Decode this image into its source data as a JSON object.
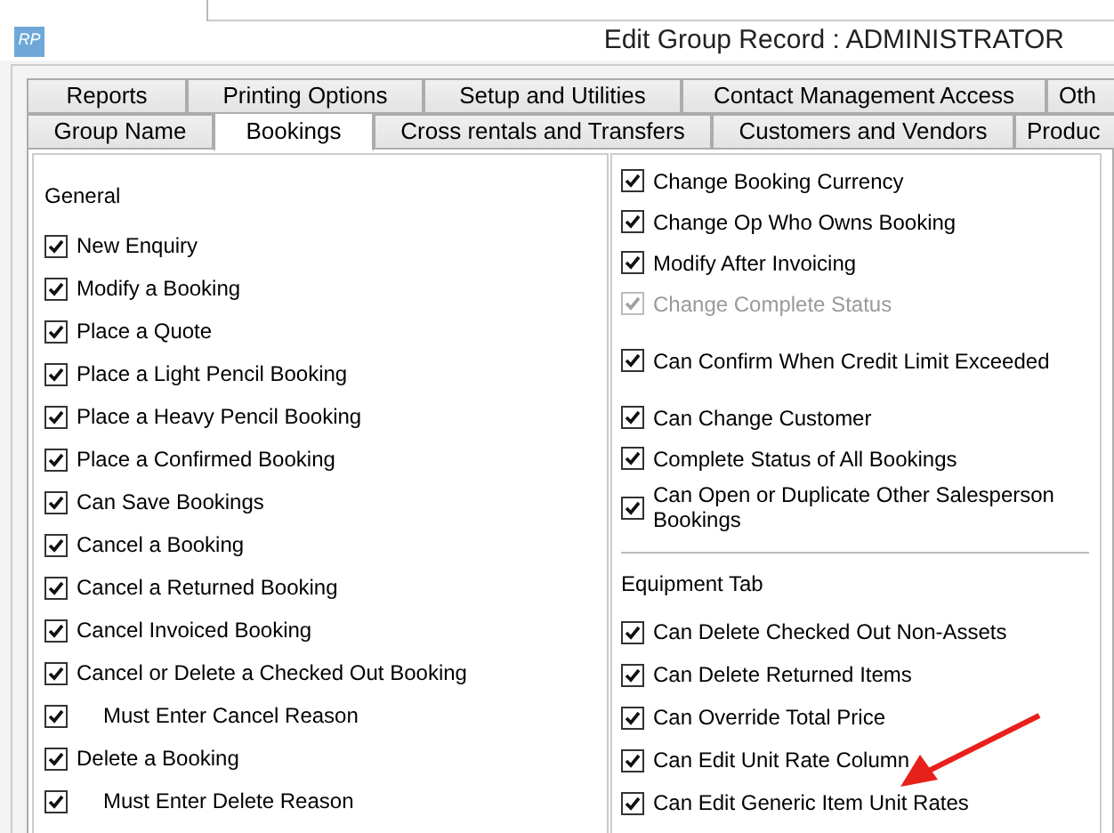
{
  "window": {
    "title": "Edit Group Record : ADMINISTRATOR",
    "icon_text": "RP"
  },
  "tab_rows": [
    [
      {
        "label": "Reports",
        "selected": false
      },
      {
        "label": "Printing Options",
        "selected": false
      },
      {
        "label": "Setup and Utilities",
        "selected": false
      },
      {
        "label": "Contact Management Access",
        "selected": false
      },
      {
        "label": "Oth",
        "selected": false
      }
    ],
    [
      {
        "label": "Group Name",
        "selected": false
      },
      {
        "label": "Bookings",
        "selected": true
      },
      {
        "label": "Cross rentals and Transfers",
        "selected": false
      },
      {
        "label": "Customers and Vendors",
        "selected": false
      },
      {
        "label": "Produc",
        "selected": false
      }
    ]
  ],
  "left_panel": {
    "heading": "General",
    "items": [
      {
        "label": "New Enquiry",
        "checked": true,
        "kind": "main"
      },
      {
        "label": "Modify a Booking",
        "checked": true,
        "kind": "main"
      },
      {
        "label": "Place a Quote",
        "checked": true,
        "kind": "main"
      },
      {
        "label": "Place a Light Pencil Booking",
        "checked": true,
        "kind": "main"
      },
      {
        "label": "Place a Heavy Pencil Booking",
        "checked": true,
        "kind": "main"
      },
      {
        "label": "Place a Confirmed Booking",
        "checked": true,
        "kind": "main"
      },
      {
        "label": "Can Save Bookings",
        "checked": true,
        "kind": "main"
      },
      {
        "label": "Cancel a Booking",
        "checked": true,
        "kind": "main"
      },
      {
        "label": "Cancel a Returned Booking",
        "checked": true,
        "kind": "main"
      },
      {
        "label": "Cancel Invoiced Booking",
        "checked": true,
        "kind": "main"
      },
      {
        "label": "Cancel or Delete a Checked Out Booking",
        "checked": true,
        "kind": "main"
      },
      {
        "label": "Must Enter Cancel Reason",
        "checked": true,
        "kind": "sub"
      },
      {
        "label": "Delete a Booking",
        "checked": true,
        "kind": "main"
      },
      {
        "label": "Must Enter Delete Reason",
        "checked": true,
        "kind": "sub"
      }
    ]
  },
  "right_panel": {
    "groups": [
      [
        {
          "label": "Change Booking Currency",
          "checked": true,
          "disabled": false
        },
        {
          "label": "Change Op Who Owns Booking",
          "checked": true,
          "disabled": false
        },
        {
          "label": "Modify After Invoicing",
          "checked": true,
          "disabled": false
        },
        {
          "label": "Change Complete Status",
          "checked": true,
          "disabled": true
        }
      ],
      [
        {
          "label": "Can Confirm When Credit Limit Exceeded",
          "checked": true,
          "disabled": false
        }
      ],
      [
        {
          "label": "Can Change Customer",
          "checked": true,
          "disabled": false
        },
        {
          "label": "Complete Status of All Bookings",
          "checked": true,
          "disabled": false
        },
        {
          "label": "Can Open or Duplicate Other Salesperson Bookings",
          "checked": true,
          "disabled": false
        }
      ]
    ],
    "section_heading": "Equipment Tab",
    "section_items": [
      {
        "label": "Can Delete Checked Out Non-Assets",
        "checked": true,
        "disabled": false
      },
      {
        "label": "Can Delete Returned Items",
        "checked": true,
        "disabled": false
      },
      {
        "label": "Can Override Total Price",
        "checked": true,
        "disabled": false
      },
      {
        "label": "Can Edit Unit Rate Column",
        "checked": true,
        "disabled": false
      },
      {
        "label": "Can Edit Generic Item Unit Rates",
        "checked": true,
        "disabled": false
      }
    ]
  }
}
